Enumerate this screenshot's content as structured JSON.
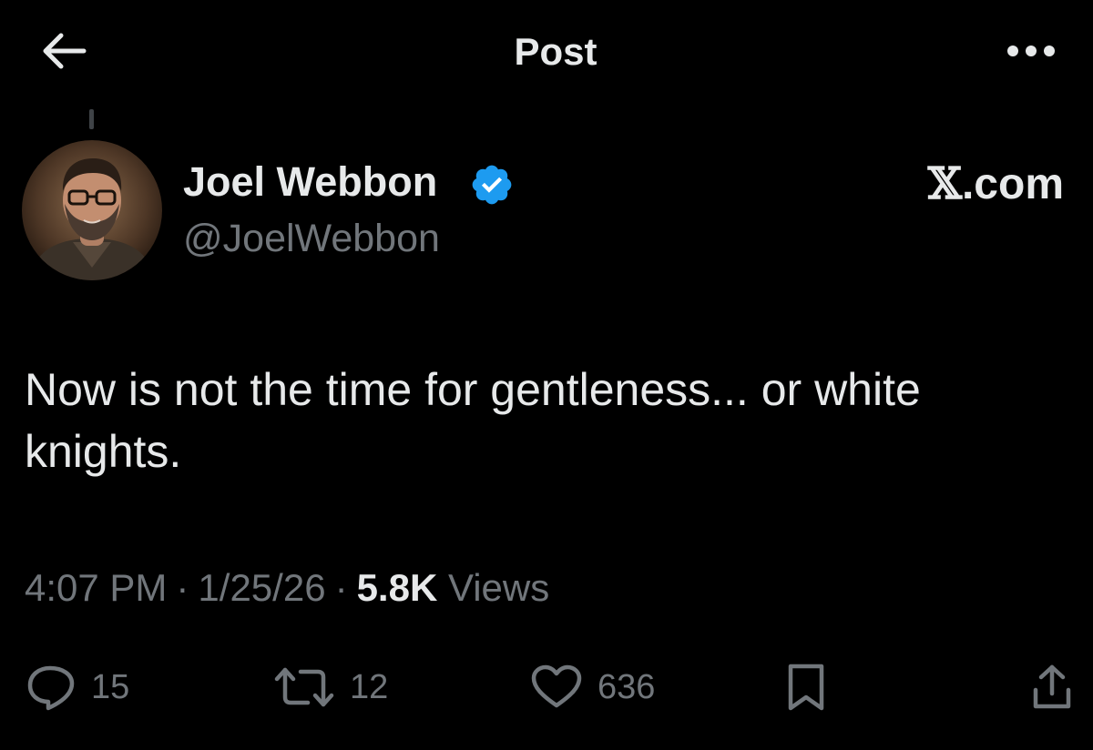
{
  "header": {
    "title": "Post",
    "back_icon": "arrow-left-icon",
    "more_icon": "more-horizontal-icon"
  },
  "author": {
    "display_name": "Joel Webbon",
    "handle": "@JoelWebbon",
    "verified_icon": "verified-badge-icon",
    "verified_color": "#1d9bf0"
  },
  "source": {
    "logo_glyph": "𝕏",
    "label": ".com"
  },
  "post": {
    "text": "Now is not the time for gentleness... or white knights.",
    "time": "4:07 PM",
    "separator": "·",
    "date": "1/25/26",
    "views_count": "5.8K",
    "views_label": "Views"
  },
  "actions": {
    "reply_count": "15",
    "repost_count": "12",
    "like_count": "636"
  },
  "colors": {
    "background": "#000000",
    "primary_text": "#e7e9ea",
    "secondary_text": "#71767b",
    "accent": "#1d9bf0"
  }
}
